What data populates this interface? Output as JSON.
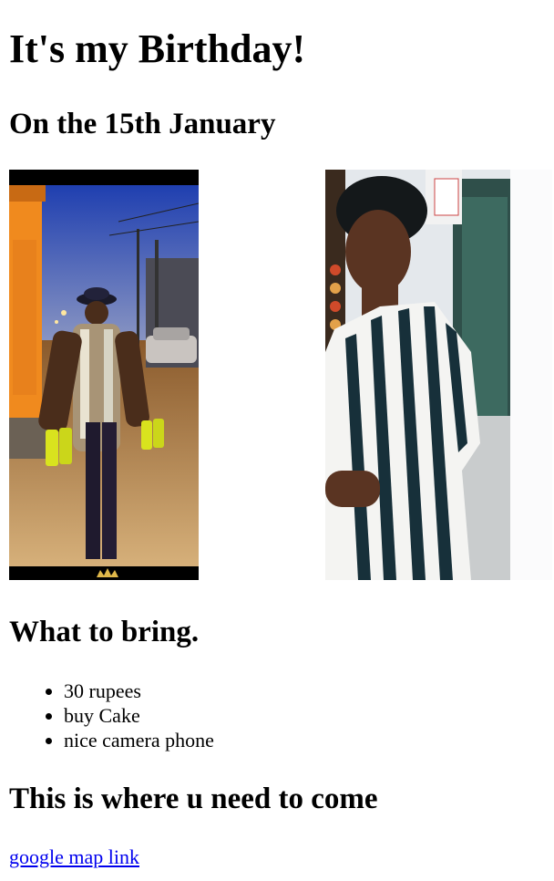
{
  "header": {
    "title": "It's my Birthday!",
    "date": "On the 15th January"
  },
  "photos": [
    {
      "name": "photo-street"
    },
    {
      "name": "photo-portrait"
    }
  ],
  "bring": {
    "heading": "What to bring.",
    "items": [
      "30 rupees",
      "buy Cake",
      "nice camera phone"
    ]
  },
  "location": {
    "heading": "This is where u need to come",
    "link_text": "google map link"
  },
  "colors": {
    "link": "#0000ee",
    "text": "#000000",
    "background": "#ffffff"
  }
}
